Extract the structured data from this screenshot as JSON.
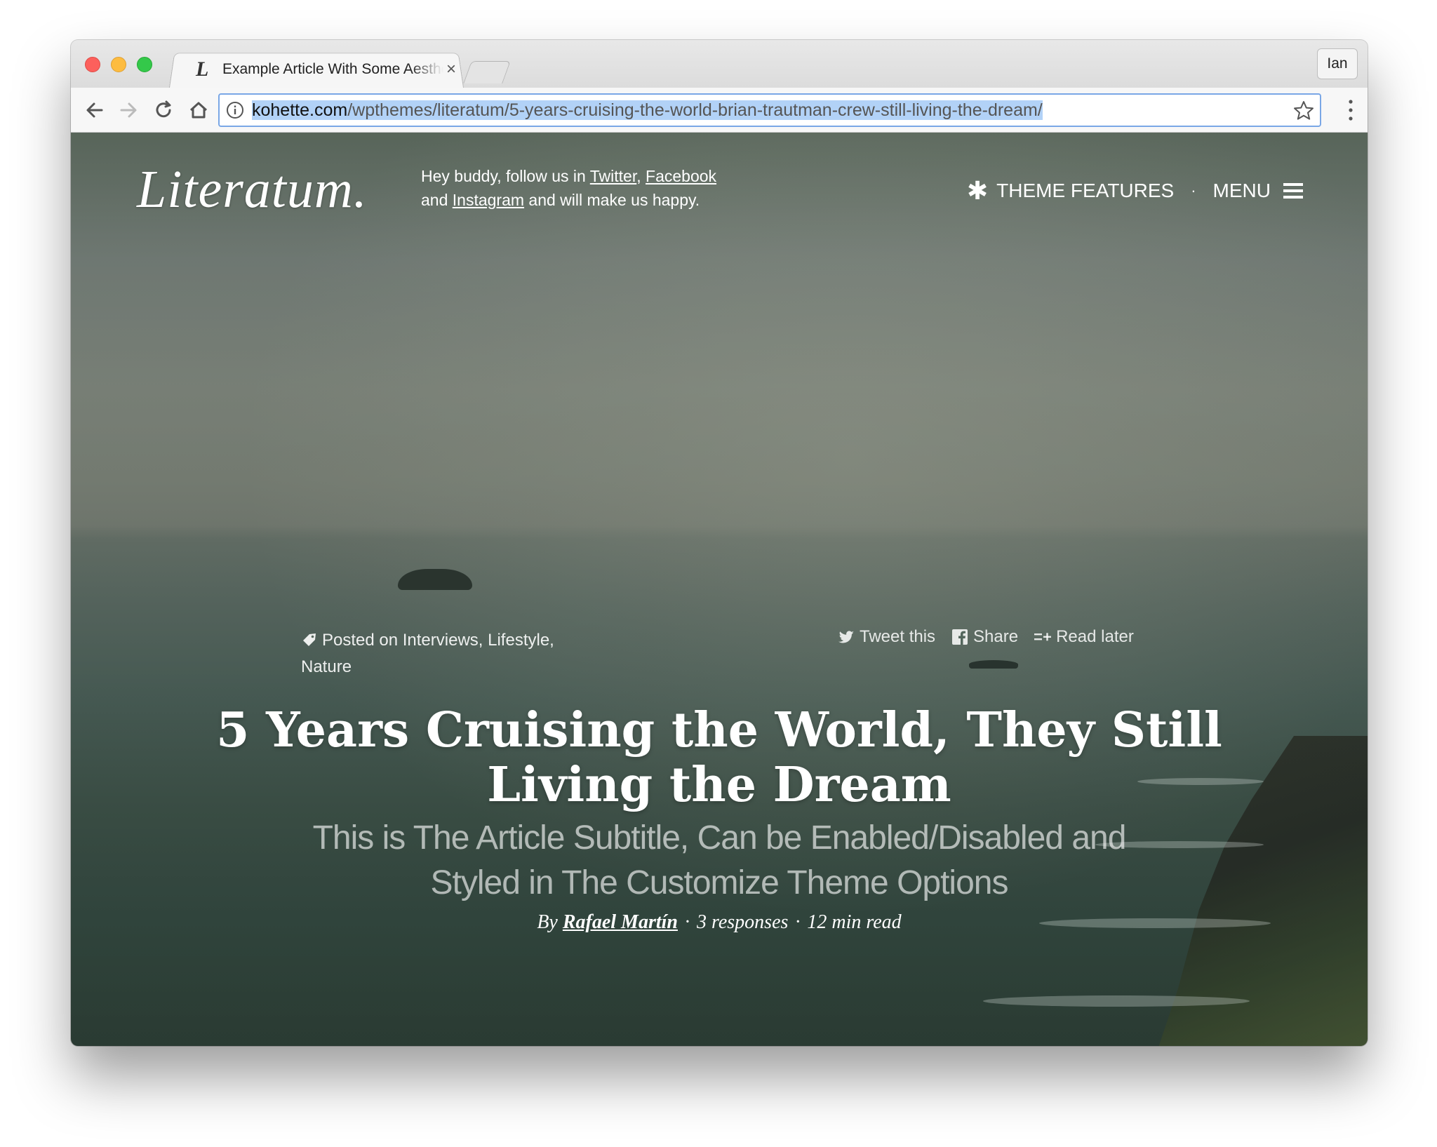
{
  "browser": {
    "tab_favicon": "L",
    "tab_title": "Example Article With Some Aesthetic",
    "tab_close": "×",
    "profile_name": "Ian",
    "url_domain": "kohette.com",
    "url_path": "/wpthemes/literatum/5-years-cruising-the-world-brian-trautman-crew-still-living-the-dream/",
    "icons": [
      "back-arrow-icon",
      "forward-arrow-icon",
      "reload-icon",
      "home-icon",
      "info-icon",
      "bookmark-star-icon",
      "kebab-menu-icon"
    ]
  },
  "site": {
    "logo": "Literatum.",
    "tagline_prefix": "Hey buddy, follow us in ",
    "link_twitter": "Twitter",
    "comma": ", ",
    "link_facebook": "Facebook",
    "and": "and ",
    "link_instagram": "Instagram",
    "tagline_suffix": " and will make us happy.",
    "nav_features": "THEME FEATURES",
    "nav_dot": "·",
    "nav_menu": "MENU"
  },
  "article": {
    "posted_prefix": "Posted on ",
    "categories": "Interviews, Lifestyle, Nature",
    "share_tweet": "Tweet this",
    "share_share": "Share",
    "share_later": "Read later",
    "title": "5 Years Cruising the World, They Still Living the Dream",
    "subtitle": "This is The Article Subtitle, Can be Enabled/Disabled and Styled in The Customize Theme Options",
    "by": "By ",
    "author": "Rafael Martín",
    "sep": "·",
    "responses": "3 responses",
    "read_time": "12 min read"
  },
  "colors": {
    "accent_selection": "#b2d2f7",
    "omnibox_focus": "#7aa7e6",
    "text_on_hero": "#ffffff"
  }
}
